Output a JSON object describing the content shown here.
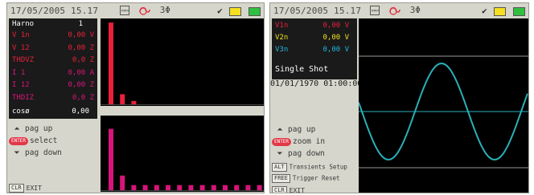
{
  "left": {
    "status": {
      "datetime": "17/05/2005 15.17",
      "phase": "3Φ"
    },
    "harmonic_panel": {
      "title": "Harno",
      "order": "1",
      "rows": [
        {
          "label": "V 1n",
          "value": "0,00 V"
        },
        {
          "label": "V 12",
          "value": "0,00 Z"
        },
        {
          "label": "THDVZ",
          "value": "0,0 Z"
        },
        {
          "label": "I 1",
          "value": "0,00 A"
        },
        {
          "label": "I 12",
          "value": "0,00 Z"
        },
        {
          "label": "THDIZ",
          "value": "0,0 Z"
        }
      ],
      "cos_label": "cosø",
      "cos_value": "0,00"
    },
    "controls": {
      "page_up": "pag up",
      "select": "select",
      "page_down": "pag down",
      "exit_key": "CLR",
      "exit": "EXIT"
    },
    "colors": {
      "voltage": "#e8203a",
      "current": "#d8147a",
      "cos": "#ffffff"
    },
    "voltage_harmonics": [
      0.97,
      0.12,
      0.04,
      0.0,
      0.0,
      0.0,
      0.0,
      0.0,
      0.0,
      0.0
    ],
    "current_harmonics": [
      0.84,
      0.2,
      0.07,
      0.07,
      0.07,
      0.07,
      0.07,
      0.07,
      0.07,
      0.07,
      0.07,
      0.07,
      0.07,
      0.07
    ]
  },
  "right": {
    "status": {
      "datetime": "17/05/2005 15.17",
      "phase": "3Φ"
    },
    "channels": [
      {
        "label": "V1n",
        "value": "0,00 V",
        "color": "#e8203a"
      },
      {
        "label": "V2n",
        "value": "0,00 V",
        "color": "#f0e020"
      },
      {
        "label": "V3n",
        "value": "0,00 V",
        "color": "#20b8e0"
      }
    ],
    "mode": "Single Shot",
    "timestamp": "01/01/1970 01:00:00",
    "controls": {
      "page_up": "pag up",
      "zoom_in": "zoom in",
      "page_down": "pag down",
      "transients_key": "ALT",
      "transients": "Transients Setup",
      "trigger_key": "FREE",
      "trigger": "Trigger Reset",
      "exit_key": "CLR",
      "exit": "EXIT"
    },
    "waveform_color": "#2ab0b8"
  }
}
